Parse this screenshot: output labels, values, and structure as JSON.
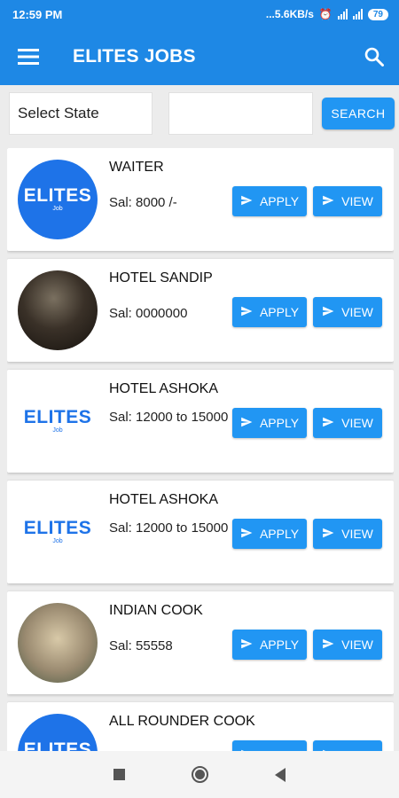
{
  "status_bar": {
    "time": "12:59 PM",
    "network_speed": "...5.6KB/s",
    "battery": "79"
  },
  "app_bar": {
    "title": "ELITES JOBS"
  },
  "filters": {
    "state_select": "Select State",
    "search_field_value": "",
    "search_button": "SEARCH"
  },
  "jobs": [
    {
      "title": "WAITER",
      "salary": "Sal: 8000 /-",
      "logo": "elites-blue"
    },
    {
      "title": "HOTEL SANDIP",
      "salary": "Sal: 0000000",
      "logo": "photo-dark"
    },
    {
      "title": "HOTEL ASHOKA",
      "salary": "Sal: 12000 to 15000",
      "logo": "elites-white"
    },
    {
      "title": "HOTEL ASHOKA",
      "salary": "Sal: 12000 to 15000",
      "logo": "elites-white"
    },
    {
      "title": "INDIAN COOK",
      "salary": "Sal: 55558",
      "logo": "photo-light"
    },
    {
      "title": "ALL ROUNDER COOK",
      "salary": "",
      "logo": "elites-blue"
    }
  ],
  "job_buttons": {
    "apply": "APPLY",
    "view": "VIEW"
  },
  "logo_text": {
    "word": "ELITES",
    "sub": "Job"
  },
  "colors": {
    "primary": "#1e88e5",
    "button": "#2196f3",
    "background": "#ececec"
  },
  "icons": {
    "menu": "menu-icon",
    "search": "search-icon",
    "apply": "send-icon",
    "view": "send-icon"
  }
}
